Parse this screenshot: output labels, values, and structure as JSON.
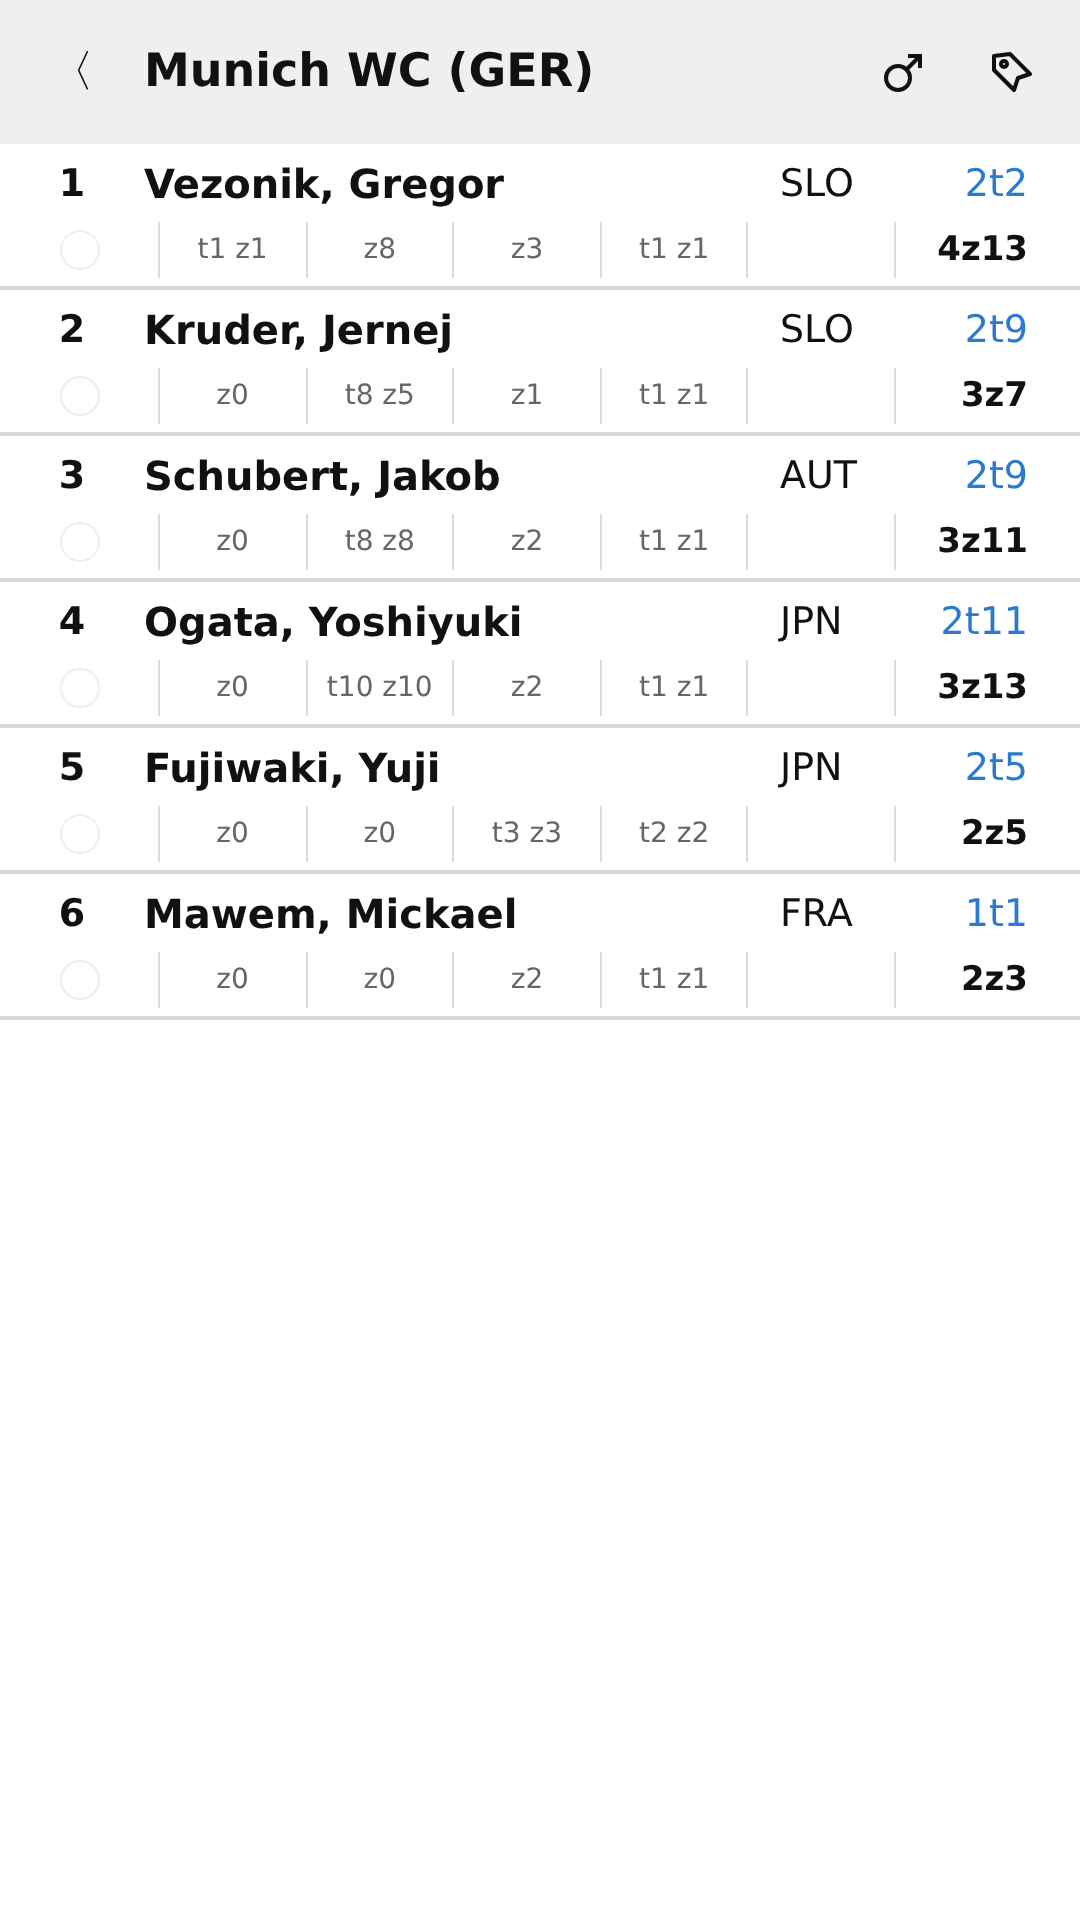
{
  "header": {
    "back": "〈",
    "title": "Munich WC (GER)"
  },
  "athletes": [
    {
      "rank": "1",
      "name": "Vezonik, Gregor",
      "country": "SLO",
      "tops": "2t2",
      "zones": "4z13",
      "checked": false,
      "boulders": [
        "t1 z1",
        "z8",
        "z3",
        "t1 z1"
      ]
    },
    {
      "rank": "2",
      "name": "Kruder, Jernej",
      "country": "SLO",
      "tops": "2t9",
      "zones": "3z7",
      "checked": false,
      "boulders": [
        "z0",
        "t8 z5",
        "z1",
        "t1 z1"
      ]
    },
    {
      "rank": "3",
      "name": "Schubert, Jakob",
      "country": "AUT",
      "tops": "2t9",
      "zones": "3z11",
      "checked": false,
      "boulders": [
        "z0",
        "t8 z8",
        "z2",
        "t1 z1"
      ]
    },
    {
      "rank": "4",
      "name": "Ogata, Yoshiyuki",
      "country": "JPN",
      "tops": "2t11",
      "zones": "3z13",
      "checked": false,
      "boulders": [
        "z0",
        "t10 z10",
        "z2",
        "t1 z1"
      ]
    },
    {
      "rank": "5",
      "name": "Fujiwaki, Yuji",
      "country": "JPN",
      "tops": "2t5",
      "zones": "2z5",
      "checked": false,
      "boulders": [
        "z0",
        "z0",
        "t3 z3",
        "t2 z2"
      ]
    },
    {
      "rank": "6",
      "name": "Mawem, Mickael",
      "country": "FRA",
      "tops": "1t1",
      "zones": "2z3",
      "checked": false,
      "boulders": [
        "z0",
        "z0",
        "z2",
        "t1 z1"
      ]
    }
  ]
}
